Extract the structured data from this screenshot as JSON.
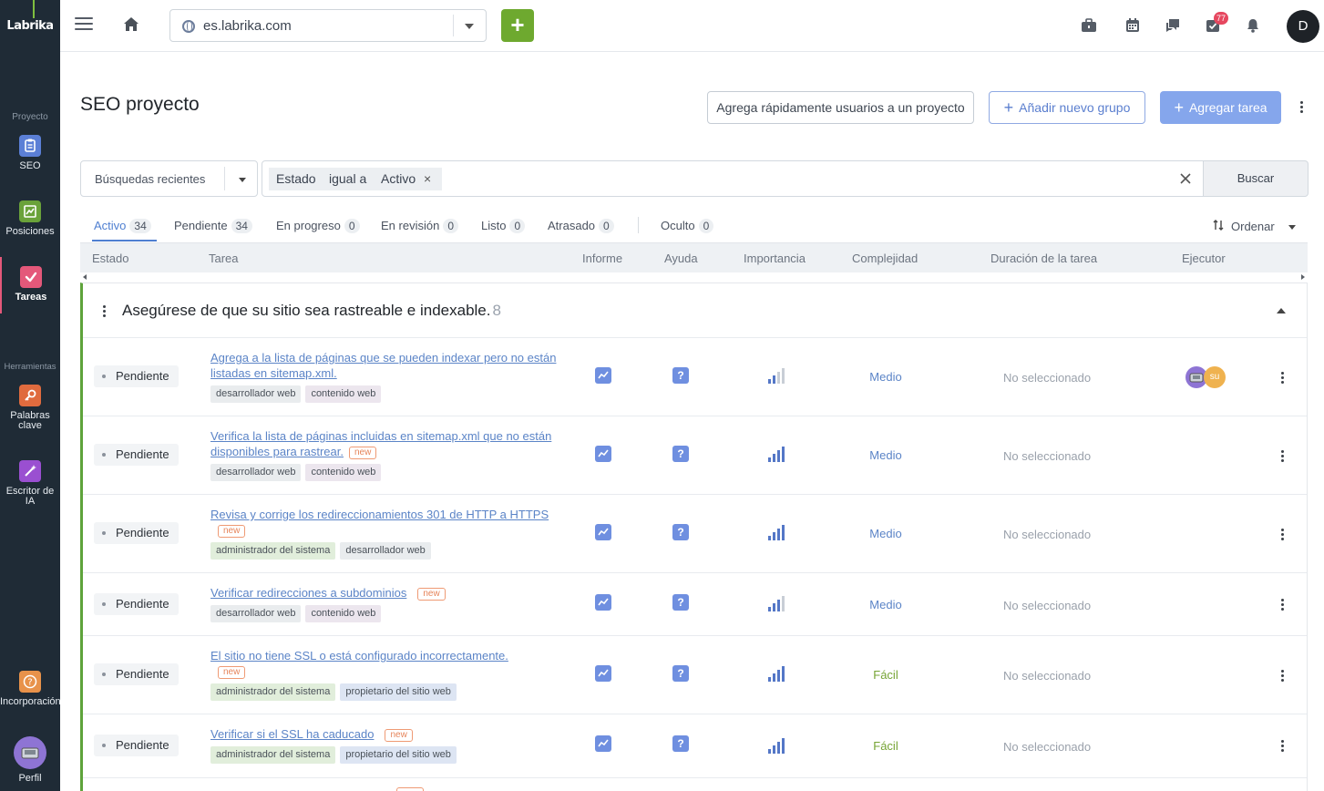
{
  "sidebar": {
    "logo": "Labrika",
    "section_project": "Proyecto",
    "section_tools": "Herramientas",
    "items": [
      {
        "label": "SEO",
        "color": "#5b7fd6"
      },
      {
        "label": "Posiciones",
        "color": "#6aa23a"
      },
      {
        "label": "Tareas",
        "color": "#e4587a"
      },
      {
        "label": "Palabras clave",
        "color": "#e06b3e"
      },
      {
        "label": "Escritor de IA",
        "color": "#9a4fd1"
      },
      {
        "label": "Incorporación",
        "color": "#e8924a"
      },
      {
        "label": "Perfil",
        "color": "#8e74d4"
      }
    ]
  },
  "header": {
    "site": "es.labrika.com",
    "plus": "+",
    "notifications_count": "77",
    "avatar_initial": "D"
  },
  "page": {
    "title": "SEO proyecto",
    "btn_add_users": "Agrega rápidamente usuarios a un proyecto",
    "btn_add_group": "Añadir nuevo grupo",
    "btn_add_task": "Agregar tarea"
  },
  "filter": {
    "recent": "Búsquedas recientes",
    "field": "Estado",
    "operator": "igual a",
    "value": "Activo",
    "search": "Buscar"
  },
  "tabs": [
    {
      "label": "Activo",
      "count": "34"
    },
    {
      "label": "Pendiente",
      "count": "34"
    },
    {
      "label": "En progreso",
      "count": "0"
    },
    {
      "label": "En revisión",
      "count": "0"
    },
    {
      "label": "Listo",
      "count": "0"
    },
    {
      "label": "Atrasado",
      "count": "0"
    },
    {
      "label": "Oculto",
      "count": "0"
    }
  ],
  "sort_label": "Ordenar",
  "columns": [
    "Estado",
    "Tarea",
    "Informe",
    "Ayuda",
    "Importancia",
    "Complejidad",
    "Duración de la tarea",
    "Ejecutor"
  ],
  "group": {
    "title": "Asegúrese de que su sitio sea rastreable e indexable.",
    "count": "8"
  },
  "new_label": "new",
  "rows": [
    {
      "status": "Pendiente",
      "task": "Agrega a la lista de páginas que se pueden indexar pero no están listadas en sitemap.xml.",
      "tags": [
        "desarrollador web",
        "contenido web"
      ],
      "importance": 2,
      "complexity": "Medio",
      "duration": "No seleccionado",
      "executor": "su"
    },
    {
      "status": "Pendiente",
      "task": "Verifica la lista de páginas incluidas en sitemap.xml que no están disponibles para rastrear.",
      "tags": [
        "desarrollador web",
        "contenido web"
      ],
      "importance": 4,
      "complexity": "Medio",
      "duration": "No seleccionado"
    },
    {
      "status": "Pendiente",
      "task": "Revisa y corrige los redireccionamientos 301 de HTTP a HTTPS",
      "tags": [
        "administrador del sistema",
        "desarrollador web"
      ],
      "importance": 4,
      "complexity": "Medio",
      "duration": "No seleccionado"
    },
    {
      "status": "Pendiente",
      "task": "Verificar redirecciones a subdominios",
      "tags": [
        "desarrollador web",
        "contenido web"
      ],
      "importance": 3,
      "complexity": "Medio",
      "duration": "No seleccionado"
    },
    {
      "status": "Pendiente",
      "task": "El sitio no tiene SSL o está configurado incorrectamente.",
      "tags": [
        "administrador del sistema",
        "propietario del sitio web"
      ],
      "importance": 4,
      "complexity": "Fácil",
      "duration": "No seleccionado"
    },
    {
      "status": "Pendiente",
      "task": "Verificar si el SSL ha caducado",
      "tags": [
        "administrador del sistema",
        "propietario del sitio web"
      ],
      "importance": 4,
      "complexity": "Fácil",
      "duration": "No seleccionado"
    }
  ]
}
